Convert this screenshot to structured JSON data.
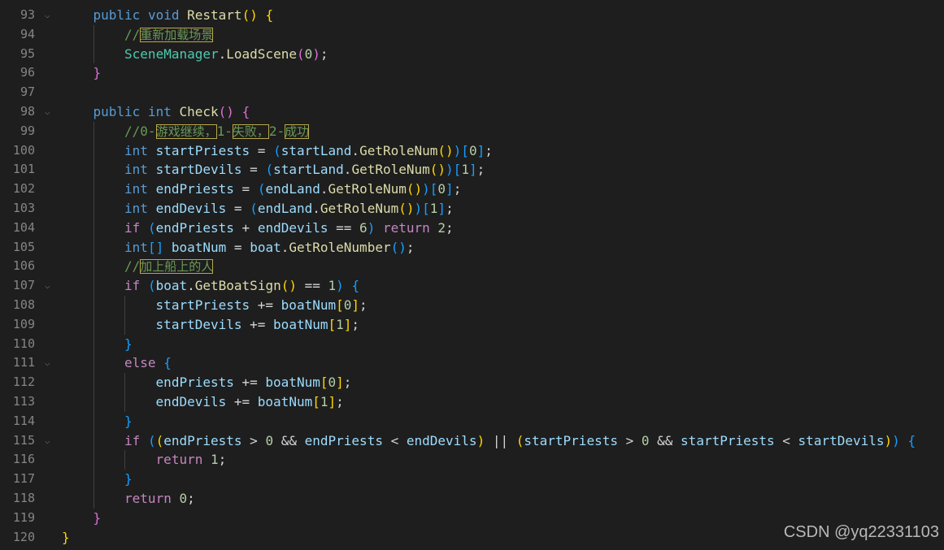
{
  "editor": {
    "language": "csharp",
    "theme": "dark",
    "fold_icon": "chevron-down",
    "lines": [
      {
        "n": "93",
        "fold": true,
        "indent": 1,
        "tokens": [
          [
            "kw",
            "public"
          ],
          [
            "op",
            " "
          ],
          [
            "kw",
            "void"
          ],
          [
            "op",
            " "
          ],
          [
            "fn",
            "Restart"
          ],
          [
            "b1",
            "()"
          ],
          [
            "op",
            " "
          ],
          [
            "b1",
            "{"
          ]
        ]
      },
      {
        "n": "94",
        "fold": false,
        "indent": 2,
        "tokens": [
          [
            "cm",
            "//"
          ],
          [
            "cjk",
            "重新加载场景"
          ]
        ]
      },
      {
        "n": "95",
        "fold": false,
        "indent": 2,
        "tokens": [
          [
            "type",
            "SceneManager"
          ],
          [
            "op",
            "."
          ],
          [
            "fn",
            "LoadScene"
          ],
          [
            "b2",
            "("
          ],
          [
            "num",
            "0"
          ],
          [
            "b2",
            ")"
          ],
          [
            "op",
            ";"
          ]
        ]
      },
      {
        "n": "96",
        "fold": false,
        "indent": 1,
        "tokens": [
          [
            "b2",
            "}"
          ]
        ]
      },
      {
        "n": "97",
        "fold": false,
        "indent": 0,
        "tokens": []
      },
      {
        "n": "98",
        "fold": true,
        "indent": 1,
        "tokens": [
          [
            "kw",
            "public"
          ],
          [
            "op",
            " "
          ],
          [
            "kw",
            "int"
          ],
          [
            "op",
            " "
          ],
          [
            "fn",
            "Check"
          ],
          [
            "b2",
            "()"
          ],
          [
            "op",
            " "
          ],
          [
            "b2",
            "{"
          ]
        ]
      },
      {
        "n": "99",
        "fold": false,
        "indent": 2,
        "tokens": [
          [
            "cm",
            "//0-"
          ],
          [
            "cjk",
            "游戏继续，"
          ],
          [
            "cm",
            "1-"
          ],
          [
            "cjk",
            "失败，"
          ],
          [
            "cm",
            "2-"
          ],
          [
            "cjk",
            "成功"
          ]
        ]
      },
      {
        "n": "100",
        "fold": false,
        "indent": 2,
        "tokens": [
          [
            "kw",
            "int"
          ],
          [
            "op",
            " "
          ],
          [
            "var",
            "startPriests"
          ],
          [
            "op",
            " = "
          ],
          [
            "b3",
            "("
          ],
          [
            "var",
            "startLand"
          ],
          [
            "op",
            "."
          ],
          [
            "fn",
            "GetRoleNum"
          ],
          [
            "b1",
            "()"
          ],
          [
            "b3",
            ")"
          ],
          [
            "b3",
            "["
          ],
          [
            "num",
            "0"
          ],
          [
            "b3",
            "]"
          ],
          [
            "op",
            ";"
          ]
        ]
      },
      {
        "n": "101",
        "fold": false,
        "indent": 2,
        "tokens": [
          [
            "kw",
            "int"
          ],
          [
            "op",
            " "
          ],
          [
            "var",
            "startDevils"
          ],
          [
            "op",
            " = "
          ],
          [
            "b3",
            "("
          ],
          [
            "var",
            "startLand"
          ],
          [
            "op",
            "."
          ],
          [
            "fn",
            "GetRoleNum"
          ],
          [
            "b1",
            "()"
          ],
          [
            "b3",
            ")"
          ],
          [
            "b3",
            "["
          ],
          [
            "num",
            "1"
          ],
          [
            "b3",
            "]"
          ],
          [
            "op",
            ";"
          ]
        ]
      },
      {
        "n": "102",
        "fold": false,
        "indent": 2,
        "tokens": [
          [
            "kw",
            "int"
          ],
          [
            "op",
            " "
          ],
          [
            "var",
            "endPriests"
          ],
          [
            "op",
            " = "
          ],
          [
            "b3",
            "("
          ],
          [
            "var",
            "endLand"
          ],
          [
            "op",
            "."
          ],
          [
            "fn",
            "GetRoleNum"
          ],
          [
            "b1",
            "()"
          ],
          [
            "b3",
            ")"
          ],
          [
            "b3",
            "["
          ],
          [
            "num",
            "0"
          ],
          [
            "b3",
            "]"
          ],
          [
            "op",
            ";"
          ]
        ]
      },
      {
        "n": "103",
        "fold": false,
        "indent": 2,
        "tokens": [
          [
            "kw",
            "int"
          ],
          [
            "op",
            " "
          ],
          [
            "var",
            "endDevils"
          ],
          [
            "op",
            " = "
          ],
          [
            "b3",
            "("
          ],
          [
            "var",
            "endLand"
          ],
          [
            "op",
            "."
          ],
          [
            "fn",
            "GetRoleNum"
          ],
          [
            "b1",
            "()"
          ],
          [
            "b3",
            ")"
          ],
          [
            "b3",
            "["
          ],
          [
            "num",
            "1"
          ],
          [
            "b3",
            "]"
          ],
          [
            "op",
            ";"
          ]
        ]
      },
      {
        "n": "104",
        "fold": false,
        "indent": 2,
        "tokens": [
          [
            "ctl",
            "if"
          ],
          [
            "op",
            " "
          ],
          [
            "b3",
            "("
          ],
          [
            "var",
            "endPriests"
          ],
          [
            "op",
            " + "
          ],
          [
            "var",
            "endDevils"
          ],
          [
            "op",
            " == "
          ],
          [
            "num",
            "6"
          ],
          [
            "b3",
            ")"
          ],
          [
            "op",
            " "
          ],
          [
            "ctl",
            "return"
          ],
          [
            "op",
            " "
          ],
          [
            "num",
            "2"
          ],
          [
            "op",
            ";"
          ]
        ]
      },
      {
        "n": "105",
        "fold": false,
        "indent": 2,
        "tokens": [
          [
            "kw",
            "int"
          ],
          [
            "b3",
            "[]"
          ],
          [
            "op",
            " "
          ],
          [
            "var",
            "boatNum"
          ],
          [
            "op",
            " = "
          ],
          [
            "var",
            "boat"
          ],
          [
            "op",
            "."
          ],
          [
            "fn",
            "GetRoleNumber"
          ],
          [
            "b3",
            "()"
          ],
          [
            "op",
            ";"
          ]
        ]
      },
      {
        "n": "106",
        "fold": false,
        "indent": 2,
        "tokens": [
          [
            "cm",
            "//"
          ],
          [
            "cjk",
            "加上船上的人"
          ]
        ]
      },
      {
        "n": "107",
        "fold": true,
        "indent": 2,
        "tokens": [
          [
            "ctl",
            "if"
          ],
          [
            "op",
            " "
          ],
          [
            "b3",
            "("
          ],
          [
            "var",
            "boat"
          ],
          [
            "op",
            "."
          ],
          [
            "fn",
            "GetBoatSign"
          ],
          [
            "b1",
            "()"
          ],
          [
            "op",
            " == "
          ],
          [
            "num",
            "1"
          ],
          [
            "b3",
            ")"
          ],
          [
            "op",
            " "
          ],
          [
            "b3",
            "{"
          ]
        ]
      },
      {
        "n": "108",
        "fold": false,
        "indent": 3,
        "tokens": [
          [
            "var",
            "startPriests"
          ],
          [
            "op",
            " += "
          ],
          [
            "var",
            "boatNum"
          ],
          [
            "b1",
            "["
          ],
          [
            "num",
            "0"
          ],
          [
            "b1",
            "]"
          ],
          [
            "op",
            ";"
          ]
        ]
      },
      {
        "n": "109",
        "fold": false,
        "indent": 3,
        "tokens": [
          [
            "var",
            "startDevils"
          ],
          [
            "op",
            " += "
          ],
          [
            "var",
            "boatNum"
          ],
          [
            "b1",
            "["
          ],
          [
            "num",
            "1"
          ],
          [
            "b1",
            "]"
          ],
          [
            "op",
            ";"
          ]
        ]
      },
      {
        "n": "110",
        "fold": false,
        "indent": 2,
        "tokens": [
          [
            "b3",
            "}"
          ]
        ]
      },
      {
        "n": "111",
        "fold": true,
        "indent": 2,
        "tokens": [
          [
            "ctl",
            "else"
          ],
          [
            "op",
            " "
          ],
          [
            "b3",
            "{"
          ]
        ]
      },
      {
        "n": "112",
        "fold": false,
        "indent": 3,
        "tokens": [
          [
            "var",
            "endPriests"
          ],
          [
            "op",
            " += "
          ],
          [
            "var",
            "boatNum"
          ],
          [
            "b1",
            "["
          ],
          [
            "num",
            "0"
          ],
          [
            "b1",
            "]"
          ],
          [
            "op",
            ";"
          ]
        ]
      },
      {
        "n": "113",
        "fold": false,
        "indent": 3,
        "tokens": [
          [
            "var",
            "endDevils"
          ],
          [
            "op",
            " += "
          ],
          [
            "var",
            "boatNum"
          ],
          [
            "b1",
            "["
          ],
          [
            "num",
            "1"
          ],
          [
            "b1",
            "]"
          ],
          [
            "op",
            ";"
          ]
        ]
      },
      {
        "n": "114",
        "fold": false,
        "indent": 2,
        "tokens": [
          [
            "b3",
            "}"
          ]
        ]
      },
      {
        "n": "115",
        "fold": true,
        "indent": 2,
        "tokens": [
          [
            "ctl",
            "if"
          ],
          [
            "op",
            " "
          ],
          [
            "b3",
            "("
          ],
          [
            "b1",
            "("
          ],
          [
            "var",
            "endPriests"
          ],
          [
            "op",
            " > "
          ],
          [
            "num",
            "0"
          ],
          [
            "op",
            " && "
          ],
          [
            "var",
            "endPriests"
          ],
          [
            "op",
            " < "
          ],
          [
            "var",
            "endDevils"
          ],
          [
            "b1",
            ")"
          ],
          [
            "op",
            " || "
          ],
          [
            "b1",
            "("
          ],
          [
            "var",
            "startPriests"
          ],
          [
            "op",
            " > "
          ],
          [
            "num",
            "0"
          ],
          [
            "op",
            " && "
          ],
          [
            "var",
            "startPriests"
          ],
          [
            "op",
            " < "
          ],
          [
            "var",
            "startDevils"
          ],
          [
            "b1",
            ")"
          ],
          [
            "b3",
            ")"
          ],
          [
            "op",
            " "
          ],
          [
            "b3",
            "{"
          ]
        ]
      },
      {
        "n": "116",
        "fold": false,
        "indent": 3,
        "tokens": [
          [
            "ctl",
            "return"
          ],
          [
            "op",
            " "
          ],
          [
            "num",
            "1"
          ],
          [
            "op",
            ";"
          ]
        ]
      },
      {
        "n": "117",
        "fold": false,
        "indent": 2,
        "tokens": [
          [
            "b3",
            "}"
          ]
        ]
      },
      {
        "n": "118",
        "fold": false,
        "indent": 2,
        "tokens": [
          [
            "ctl",
            "return"
          ],
          [
            "op",
            " "
          ],
          [
            "num",
            "0"
          ],
          [
            "op",
            ";"
          ]
        ]
      },
      {
        "n": "119",
        "fold": false,
        "indent": 1,
        "tokens": [
          [
            "b2",
            "}"
          ]
        ]
      },
      {
        "n": "120",
        "fold": false,
        "indent": 0,
        "tokens": [
          [
            "b1",
            "}"
          ]
        ]
      }
    ]
  },
  "watermark": "CSDN @yq22331103"
}
